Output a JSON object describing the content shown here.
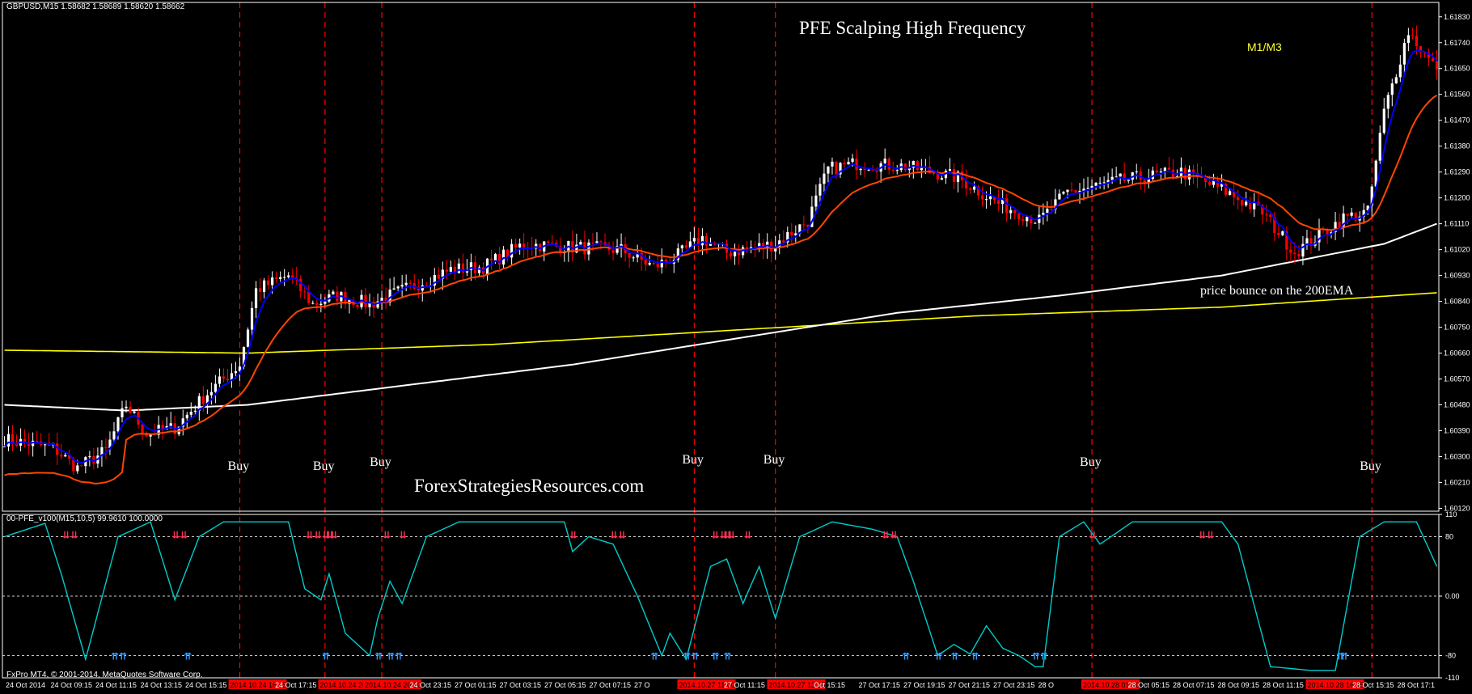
{
  "header": {
    "symbol_line": "GBPUSD,M15  1.58682 1.58689 1.58620 1.58662",
    "indicator_line": "00-PFE_v100(M15,10,5) 99.9610 100.0000",
    "copyright": "FxPro MT4, © 2001-2014, MetaQuotes Software Corp."
  },
  "annotations": {
    "title": "PFE Scalping High Frequency",
    "site": "ForexStrategiesResources.com",
    "timeframe": "M1/M3",
    "bounce": "price bounce on the 200EMA"
  },
  "colors": {
    "background": "#000000",
    "bull_candle": "#ffffff",
    "bear_candle": "#ff0000",
    "fast_ma": "#0000ff",
    "mid_ma": "#ff4500",
    "ema_200": "#ffffff",
    "slow_ma": "#ffff00",
    "pfe_line": "#00cccc",
    "signal_up": "#3399ff",
    "signal_down": "#ff3355",
    "vline": "#ff0000"
  },
  "chart_data": [
    {
      "type": "candlestick",
      "symbol": "GBPUSD",
      "timeframe": "M15",
      "price_ticks": [
        "1.61830",
        "1.61740",
        "1.61650",
        "1.61560",
        "1.61470",
        "1.61380",
        "1.61290",
        "1.61200",
        "1.61110",
        "1.61020",
        "1.60930",
        "1.60840",
        "1.60750",
        "1.60660",
        "1.60570",
        "1.60480",
        "1.60390",
        "1.60300",
        "1.60210",
        "1.60120"
      ],
      "ylim": [
        1.6011,
        1.6188
      ],
      "time_ticks": [
        "24 Oct 2014",
        "24 Oct 09:15",
        "24 Oct 11:15",
        "24 Oct 13:15",
        "24 Oct 15:15",
        "2014.10.24 16:45",
        "24 Oct 17:15",
        "2014.10.24 20:1",
        "2014.10.24 20:30",
        "24 Oct 23:15",
        "27 Oct 01:15",
        "27 Oct 03:15",
        "27 Oct 05:15",
        "27 Oct 07:15",
        "27 O",
        "2014.10.27 11:00",
        "27 Oct 11:15",
        "2014.10.27 13:15",
        "Oct 15:15",
        "27 Oct 17:15",
        "27 Oct 19:15",
        "27 Oct 21:15",
        "27 Oct 23:15",
        "28 O",
        "2014.10.28 01:00",
        "28 Oct 05:15",
        "28 Oct 07:15",
        "28 Oct 09:15",
        "28 Oct 11:15",
        "2014.10.28 16:15",
        "28 Oct 15:15",
        "28 Oct 17:1"
      ],
      "buy_labels": [
        {
          "bar": 58,
          "text": "Buy"
        },
        {
          "bar": 79,
          "text": "Buy"
        },
        {
          "bar": 93,
          "text": "Buy"
        },
        {
          "bar": 170,
          "text": "Buy"
        },
        {
          "bar": 190,
          "text": "Buy"
        },
        {
          "bar": 268,
          "text": "Buy"
        },
        {
          "bar": 337,
          "text": "Buy"
        }
      ],
      "moving_averages": [
        {
          "name": "",
          "color": "#0000ff",
          "role": "fast"
        },
        {
          "name": "",
          "color": "#ff4500",
          "role": "mid"
        },
        {
          "name": "",
          "color": "#ffffff",
          "role": "200EMA"
        },
        {
          "name": "",
          "color": "#ffff00",
          "role": "slow"
        }
      ]
    },
    {
      "type": "line",
      "name": "00-PFE_v100(M15,10,5)",
      "y_ticks": [
        "110",
        "80",
        "0.00",
        "-80",
        "-110"
      ],
      "ylim": [
        -110,
        110
      ],
      "levels": [
        80,
        0,
        -80
      ]
    }
  ]
}
